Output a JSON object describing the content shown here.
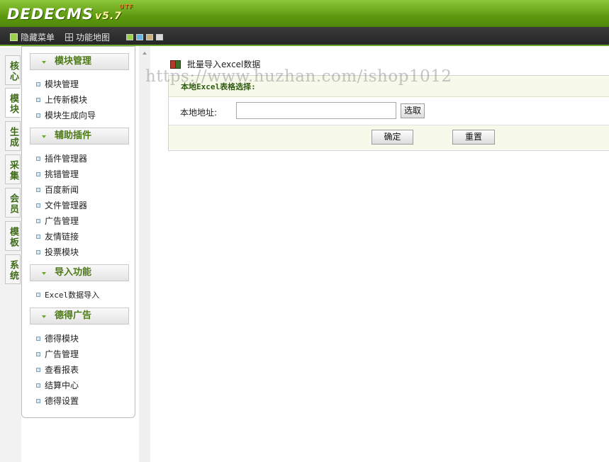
{
  "app": {
    "logo": "DEDECMS",
    "version": "v5.7",
    "edition": "UTF"
  },
  "menubar": {
    "items": [
      {
        "label": "隐藏菜单",
        "icon": "panel-icon"
      },
      {
        "label": "功能地图",
        "icon": "map-icon"
      }
    ]
  },
  "colors": {
    "accent": "#6aa82a",
    "brand_green": "#4e8708",
    "swatches": [
      "#9bd04c",
      "#6ab4e0",
      "#c8b27a",
      "#d8d8d8"
    ]
  },
  "left_tabs": [
    "核心",
    "模块",
    "生成",
    "采集",
    "会员",
    "模板",
    "系统"
  ],
  "active_tab": "模块",
  "sidebar": {
    "sections": [
      {
        "title": "模块管理",
        "items": [
          "模块管理",
          "上传新模块",
          "模块生成向导"
        ]
      },
      {
        "title": "辅助插件",
        "items": [
          "插件管理器",
          "挑错管理",
          "百度新闻",
          "文件管理器",
          "广告管理",
          "友情链接",
          "投票模块"
        ]
      },
      {
        "title": "导入功能",
        "items": [
          "Excel数据导入"
        ]
      },
      {
        "title": "德得广告",
        "items": [
          "德得模块",
          "广告管理",
          "查看报表",
          "结算中心",
          "德得设置"
        ]
      }
    ]
  },
  "main": {
    "page_title": "批量导入excel数据",
    "watermark": "https://www.huzhan.com/ishop1012",
    "panel_heading": "本地Excel表格选择:",
    "local_path_label": "本地地址:",
    "path_value": "",
    "browse_label": "选取",
    "submit_label": "确定",
    "reset_label": "重置"
  }
}
